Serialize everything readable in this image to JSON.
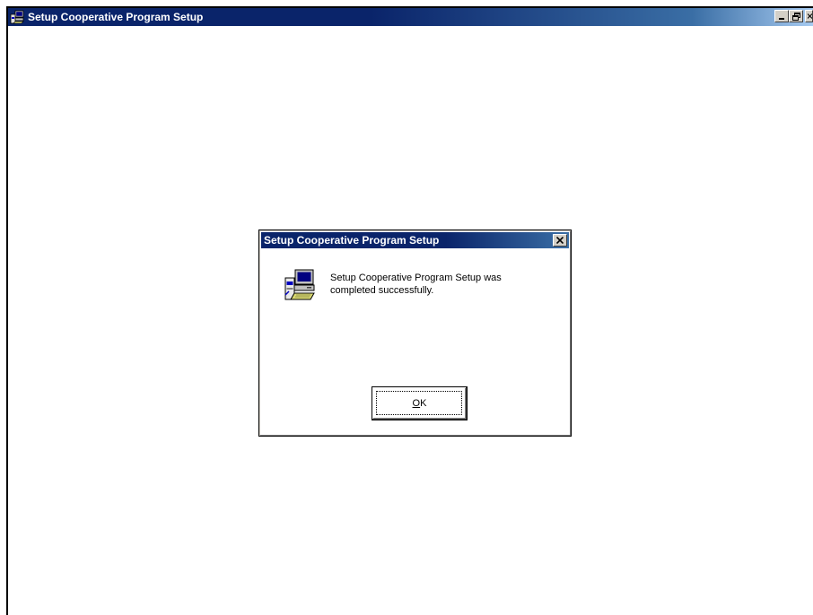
{
  "window": {
    "title": "Setup Cooperative Program Setup",
    "icon": "setup-computer-icon",
    "buttons": {
      "minimize": "minimize-icon",
      "maximize": "restore-icon",
      "close": "close-icon"
    }
  },
  "dialog": {
    "title": "Setup Cooperative Program Setup",
    "icon": "setup-computer-icon",
    "message": "Setup Cooperative Program Setup was completed successfully.",
    "ok_mnemonic": "O",
    "ok_rest": "K"
  },
  "colors": {
    "titlebar_active": "#0a246a",
    "titlebar_gradient_end": "#a6caf0",
    "button_face": "#d4d0c8"
  }
}
